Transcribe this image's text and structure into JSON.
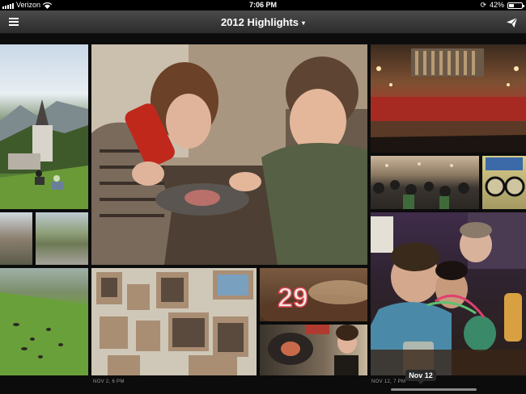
{
  "status": {
    "carrier": "Verizon",
    "time": "7:06 PM",
    "battery": "42%",
    "battery_level": 0.42
  },
  "nav": {
    "title": "2012 Highlights",
    "caret": "▾"
  },
  "dates": {
    "nov2": "NOV 2, 6 PM",
    "nov12": "NOV 12, 7 PM"
  },
  "tooltip": "Nov 12",
  "cake": {
    "number": "29"
  }
}
